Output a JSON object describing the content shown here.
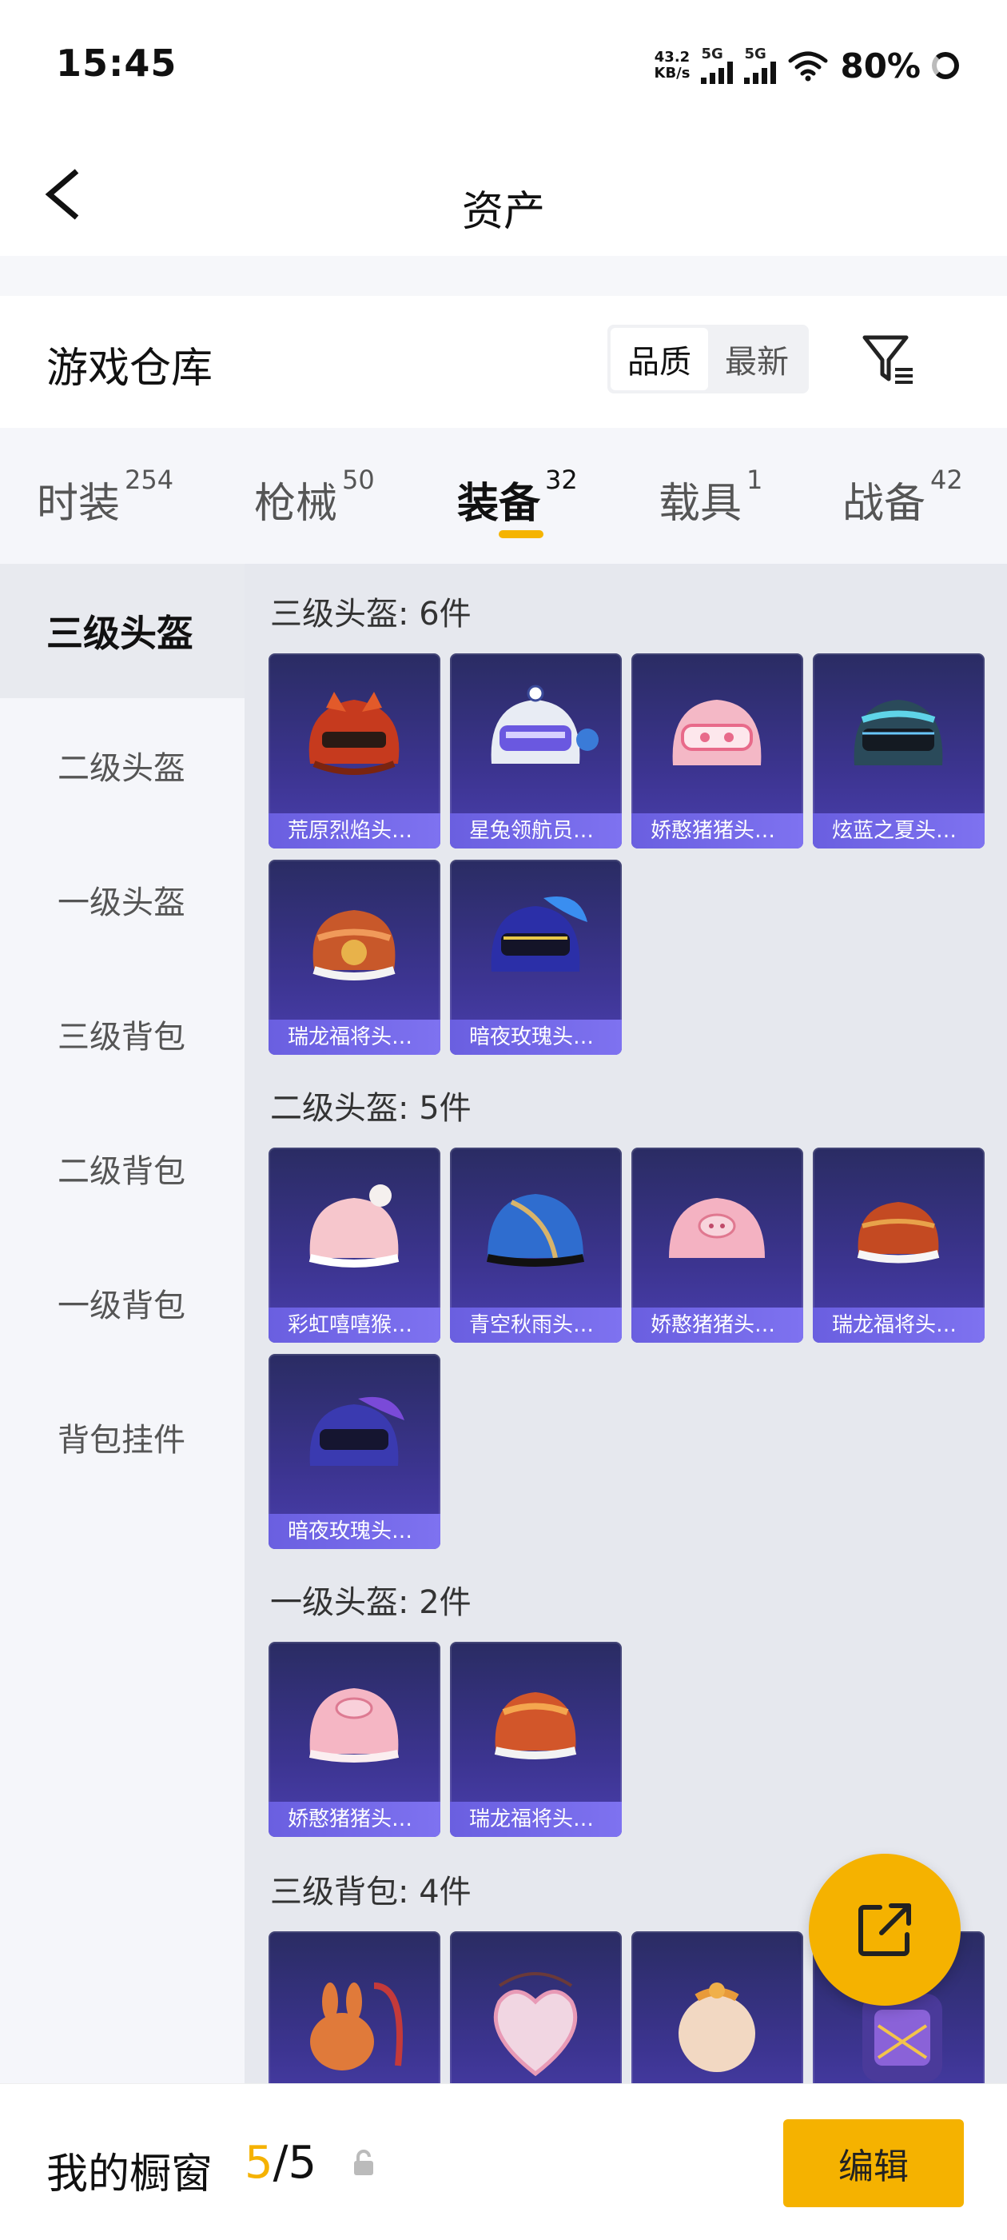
{
  "status_bar": {
    "time": "15:45",
    "speed": "43.2",
    "speed_unit": "KB/s",
    "net1": "5G",
    "net2": "5G",
    "battery": "80%"
  },
  "header": {
    "title": "资产"
  },
  "warehouse": {
    "title": "游戏仓库",
    "sort_options": [
      "品质",
      "最新"
    ],
    "active_sort": "品质"
  },
  "tabs": [
    {
      "label": "时装",
      "count": "254"
    },
    {
      "label": "枪械",
      "count": "50"
    },
    {
      "label": "装备",
      "count": "32"
    },
    {
      "label": "载具",
      "count": "1"
    },
    {
      "label": "战备",
      "count": "42"
    }
  ],
  "active_tab": "装备",
  "sidebar": [
    "三级头盔",
    "二级头盔",
    "一级头盔",
    "三级背包",
    "二级背包",
    "一级背包",
    "背包挂件"
  ],
  "active_sidebar": "三级头盔",
  "sections": [
    {
      "title": "三级头盔: 6件",
      "items": [
        "荒原烈焰头…",
        "星兔领航员…",
        "娇憨猪猪头…",
        "炫蓝之夏头…",
        "瑞龙福将头…",
        "暗夜玫瑰头…"
      ]
    },
    {
      "title": "二级头盔: 5件",
      "items": [
        "彩虹嘻嘻猴…",
        "青空秋雨头…",
        "娇憨猪猪头…",
        "瑞龙福将头…",
        "暗夜玫瑰头…"
      ]
    },
    {
      "title": "一级头盔: 2件",
      "items": [
        "娇憨猪猪头…",
        "瑞龙福将头…"
      ]
    },
    {
      "title": "三级背包: 4件",
      "items": []
    }
  ],
  "bottom": {
    "title": "我的橱窗",
    "count_current": "5",
    "count_total": "/5",
    "edit_label": "编辑"
  },
  "colors": {
    "accent": "#f5b200",
    "card_bg": "#3c3490",
    "card_label": "#7268ea"
  }
}
